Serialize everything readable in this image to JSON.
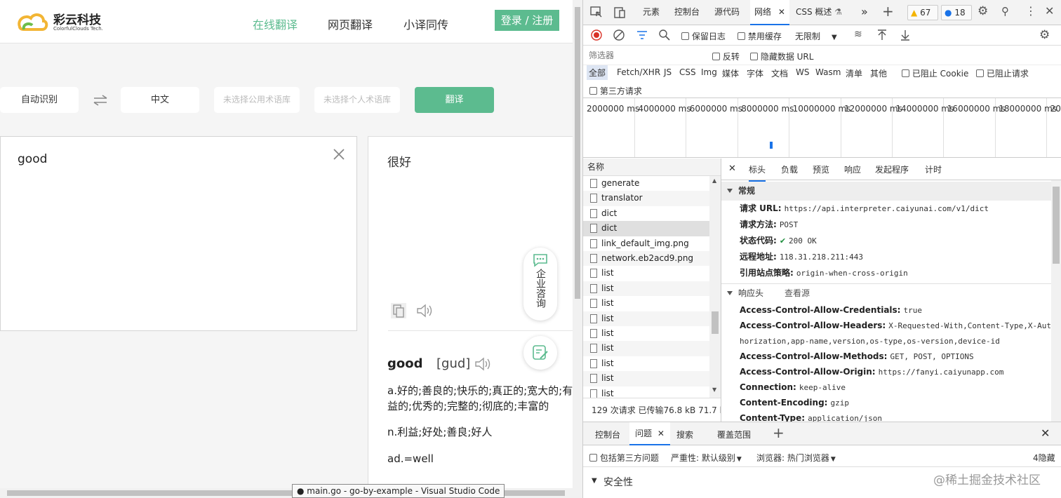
{
  "app": {
    "logo_cn": "彩云科技",
    "logo_en": "ColorfulClouds Tech.",
    "nav": [
      "在线翻译",
      "网页翻译",
      "小译同传"
    ],
    "login": "登录 / 注册",
    "source_lang": "自动识别",
    "swap_icon": "swap-arrows-icon",
    "target_lang": "中文",
    "public_glossary": "未选择公用术语库",
    "private_glossary": "未选择个人术语库",
    "translate": "翻译",
    "input_text": "good",
    "output_text": "很好",
    "dict_word": "good",
    "dict_phonetic": "[gud]",
    "definitions": [
      "a.好的;善良的;快乐的;真正的;宽大的;有益的;优秀的;完整的;彻底的;丰富的",
      "n.利益;好处;善良;好人",
      "ad.=well"
    ],
    "consult": "企业咨询",
    "accent": "#5cbb8f"
  },
  "taskbar_tooltip": "● main.go - go-by-example - Visual Studio Code",
  "devtools": {
    "tabs": [
      "元素",
      "控制台",
      "源代码",
      "网络",
      "CSS 概述"
    ],
    "warn_count": "67",
    "msg_count": "18",
    "preserve_log": "保留日志",
    "disable_cache": "禁用缓存",
    "throttle": "无限制",
    "filter_placeholder": "筛选器",
    "invert": "反转",
    "hide_data_urls": "隐藏数据 URL",
    "types": [
      "全部",
      "Fetch/XHR",
      "JS",
      "CSS",
      "Img",
      "媒体",
      "字体",
      "文档",
      "WS",
      "Wasm",
      "清单",
      "其他"
    ],
    "blocked_cookie": "已阻止 Cookie",
    "blocked_requests": "已阻止请求",
    "third_party": "第三方请求",
    "timeline_ticks": [
      "2000000 ms",
      "4000000 ms",
      "6000000 ms",
      "8000000 ms",
      "10000000 ms",
      "12000000 ms",
      "14000000 ms",
      "16000000 ms",
      "18000000 ms",
      "20"
    ],
    "name_header": "名称",
    "requests": [
      "generate",
      "translator",
      "dict",
      "dict",
      "link_default_img.png",
      "network.eb2acd9.png",
      "list",
      "list",
      "list",
      "list",
      "list",
      "list",
      "list",
      "list",
      "list"
    ],
    "summary": "129 次请求  已传输76.8 kB  71.7 k",
    "detail_tabs": [
      "标头",
      "负载",
      "预览",
      "响应",
      "发起程序",
      "计时"
    ],
    "general_title": "常规",
    "general": [
      {
        "k": "请求 URL:",
        "v": "https://api.interpreter.caiyunai.com/v1/dict"
      },
      {
        "k": "请求方法:",
        "v": "POST"
      },
      {
        "k": "状态代码:",
        "v": "200 OK"
      },
      {
        "k": "远程地址:",
        "v": "118.31.218.211:443"
      },
      {
        "k": "引用站点策略:",
        "v": "origin-when-cross-origin"
      }
    ],
    "resp_title": "响应头",
    "view_source": "查看源",
    "resp_headers": [
      {
        "k": "Access-Control-Allow-Credentials:",
        "v": "true"
      },
      {
        "k": "Access-Control-Allow-Headers:",
        "v": "X-Requested-With,Content-Type,X-Aut"
      },
      {
        "k": "",
        "v": "horization,app-name,version,os-type,os-version,device-id"
      },
      {
        "k": "Access-Control-Allow-Methods:",
        "v": "GET, POST, OPTIONS"
      },
      {
        "k": "Access-Control-Allow-Origin:",
        "v": "https://fanyi.caiyunapp.com"
      },
      {
        "k": "Connection:",
        "v": "keep-alive"
      },
      {
        "k": "Content-Encoding:",
        "v": "gzip"
      },
      {
        "k": "Content-Type:",
        "v": "application/json"
      }
    ],
    "drawer_tabs": [
      "控制台",
      "问题",
      "搜索",
      "覆盖范围"
    ],
    "include_third": "包括第三方问题",
    "severity": "严重性: 默认级别",
    "browser": "浏览器: 热门浏览器",
    "hidden": "4隐藏",
    "security": "安全性"
  },
  "watermark": "@稀土掘金技术社区"
}
